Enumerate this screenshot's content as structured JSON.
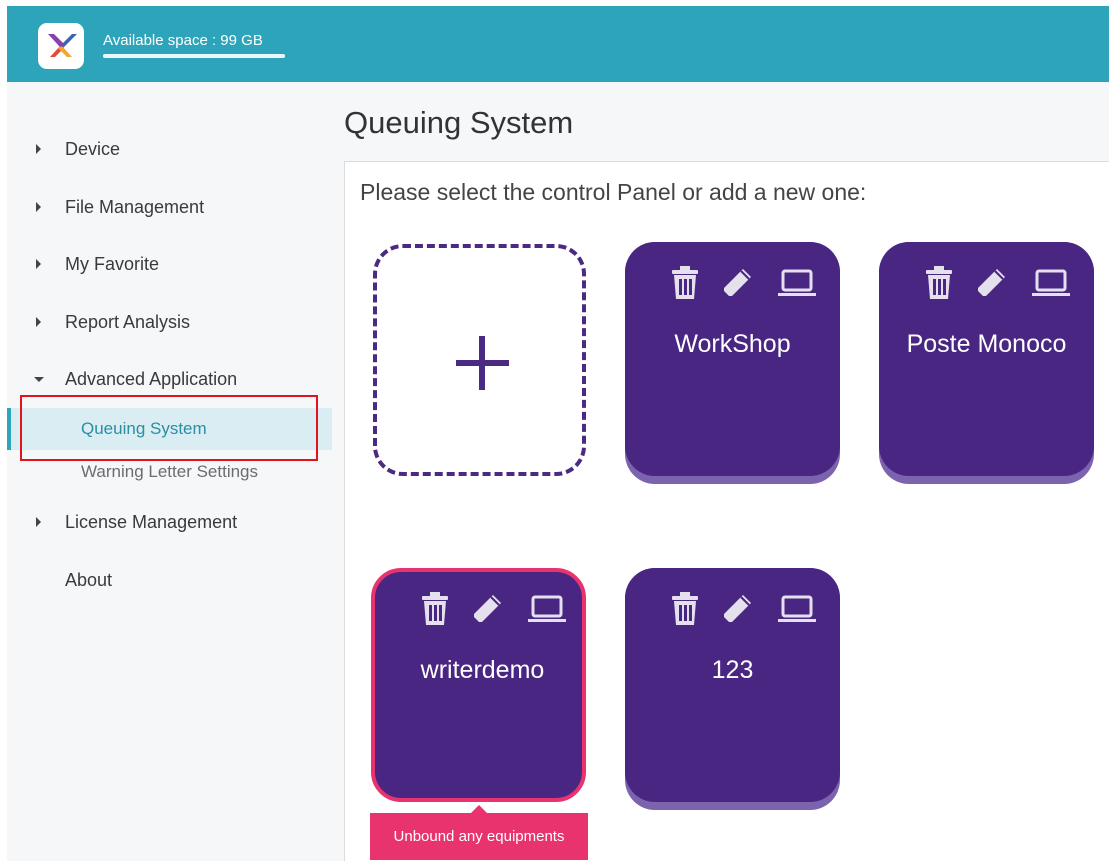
{
  "header": {
    "available_space": "Available space : 99 GB",
    "usage_fraction": 1.0,
    "color": "#2ea4bb"
  },
  "sidebar": {
    "items": [
      {
        "label": "Device",
        "expanded": false
      },
      {
        "label": "File Management",
        "expanded": false
      },
      {
        "label": "My Favorite",
        "expanded": false
      },
      {
        "label": "Report Analysis",
        "expanded": false
      },
      {
        "label": "Advanced Application",
        "expanded": true,
        "children": [
          {
            "label": "Queuing System",
            "active": true
          },
          {
            "label": "Warning Letter Settings",
            "active": false
          }
        ]
      },
      {
        "label": "License Management",
        "expanded": false
      },
      {
        "label": "About",
        "expanded": false
      }
    ]
  },
  "main": {
    "title": "Queuing System",
    "instruction": "Please select the control Panel or add a new one:",
    "add_icon": "plus-icon",
    "panels": [
      {
        "name": "WorkShop",
        "selected": false
      },
      {
        "name": "Poste Monoco",
        "selected": false
      },
      {
        "name": "writerdemo",
        "selected": true
      },
      {
        "name": "123",
        "selected": false
      }
    ],
    "card_actions": [
      "trash-icon",
      "pencil-icon",
      "laptop-icon"
    ],
    "tooltip": "Unbound any equipments"
  },
  "colors": {
    "accent": "#2ea4bb",
    "card": "#4a2683",
    "card_shadow": "#7b63ad",
    "selected_border": "#e8336f",
    "highlight_box": "#e0141e"
  }
}
